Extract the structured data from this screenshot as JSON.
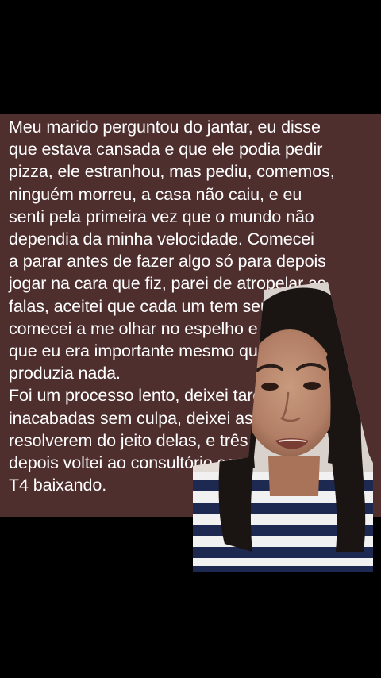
{
  "story": {
    "lines": [
      "Meu marido perguntou do jantar, eu disse",
      "que estava cansada e que ele podia pedir",
      "pizza, ele estranhou, mas pediu, comemos,",
      "ninguém morreu, a casa não caiu, e eu",
      "senti pela primeira vez que o mundo não",
      "dependia da minha velocidade. Comecei",
      "a parar antes de fazer algo só para depois",
      "jogar na cara que fiz, parei de atropelar as",
      "falas, aceitei que cada um tem seu tempo,",
      "comecei a me olhar no espelho e lembrar",
      "que eu era importante mesmo quando não",
      "produzia nada.",
      "Foi um processo lento, deixei tarefas",
      "inacabadas sem culpa, deixei as pessoas",
      "resolverem do jeito delas, e três meses",
      "depois voltei ao consultório com o meu",
      "T4 baixando."
    ]
  },
  "colors": {
    "panel": "#4f2e2e",
    "text": "#ffffff",
    "background": "#000000"
  },
  "overlay": {
    "subject": "person-cutout-webcam"
  }
}
